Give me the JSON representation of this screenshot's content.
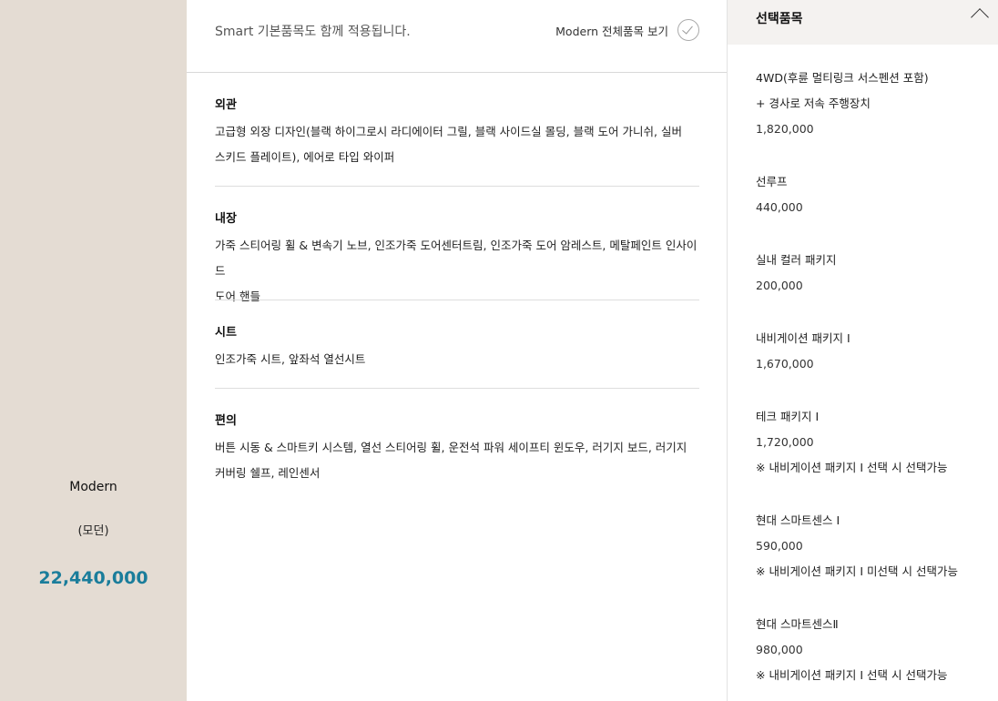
{
  "trim": {
    "name": "Modern",
    "subname": "(모던)",
    "price": "22,440,000"
  },
  "header": {
    "note": "Smart 기본품목도 함께 적용됩니다.",
    "link_label": "Modern 전체품목 보기",
    "link_icon": "check-circle-icon"
  },
  "sections": [
    {
      "title": "외관",
      "lines": [
        "고급형 외장 디자인(블랙 하이그로시 라디에이터 그릴, 블랙 사이드실 몰딩, 블랙 도어 가니쉬, 실버",
        "스키드 플레이트), 에어로 타입 와이퍼"
      ]
    },
    {
      "title": "내장",
      "lines": [
        "가죽 스티어링 휠 & 변속기 노브, 인조가죽 도어센터트림, 인조가죽 도어 암레스트, 메탈페인트 인사이드",
        "도어 핸들"
      ]
    },
    {
      "title": "시트",
      "lines": [
        "인조가죽 시트, 앞좌석 열선시트"
      ]
    },
    {
      "title": "편의",
      "lines": [
        "버튼 시동 & 스마트키 시스템, 열선 스티어링 휠, 운전석 파워 세이프티 윈도우, 러기지 보드, 러기지",
        "커버링 쉘프, 레인센서"
      ]
    }
  ],
  "options_panel": {
    "title": "선택품목",
    "collapse_icon": "chevron-up-icon",
    "options": [
      {
        "line1": "4WD(후륜 멀티링크 서스펜션 포함)",
        "line2": "+ 경사로 저속 주행장치",
        "price": "1,820,000",
        "note": ""
      },
      {
        "line1": "선루프",
        "line2": "",
        "price": "440,000",
        "note": ""
      },
      {
        "line1": "실내 컬러 패키지",
        "line2": "",
        "price": "200,000",
        "note": ""
      },
      {
        "line1": "내비게이션 패키지 Ⅰ",
        "line2": "",
        "price": "1,670,000",
        "note": ""
      },
      {
        "line1": "테크 패키지 Ⅰ",
        "line2": "",
        "price": "1,720,000",
        "note": "※ 내비게이션 패키지 Ⅰ 선택 시 선택가능"
      },
      {
        "line1": "현대 스마트센스 Ⅰ",
        "line2": "",
        "price": "590,000",
        "note": "※ 내비게이션 패키지 Ⅰ 미선택 시 선택가능"
      },
      {
        "line1": "현대 스마트센스Ⅱ",
        "line2": "",
        "price": "980,000",
        "note": "※ 내비게이션 패키지 Ⅰ 선택 시 선택가능"
      }
    ]
  },
  "colors": {
    "trim_panel_bg": "#e4dcd3",
    "price_accent": "#1a7d9b",
    "options_header_bg": "#f4f2f0"
  }
}
